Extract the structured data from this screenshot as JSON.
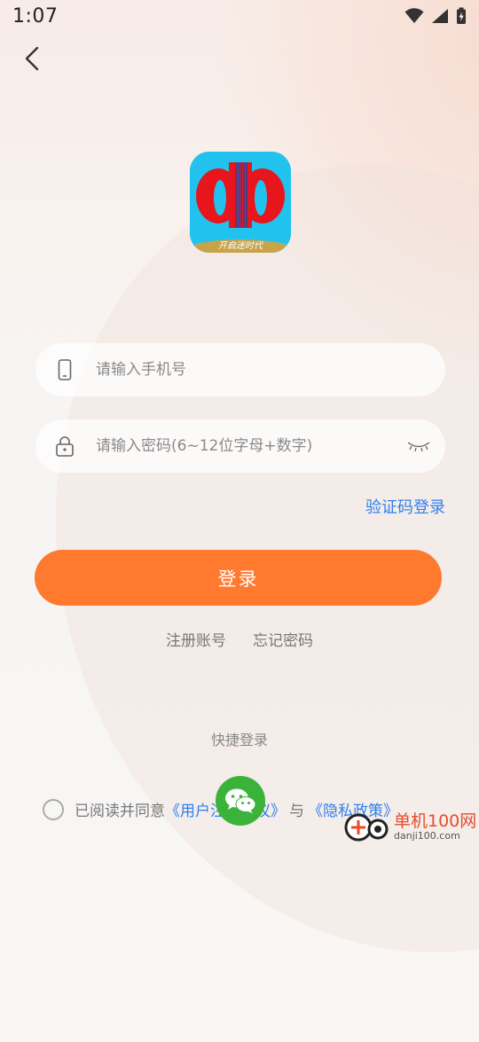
{
  "status_bar": {
    "time": "1:07"
  },
  "navigation": {
    "back_icon": "chevron-left-icon"
  },
  "logo": {
    "letters": "db",
    "banner_text": "开启迷时代"
  },
  "phone_field": {
    "icon": "phone-icon",
    "placeholder": "请输入手机号",
    "value": ""
  },
  "password_field": {
    "icon": "lock-icon",
    "placeholder": "请输入密码(6~12位字母+数字)",
    "value": "",
    "toggle_icon": "eye-closed-icon"
  },
  "code_login_label": "验证码登录",
  "login_button_label": "登录",
  "links": {
    "register": "注册账号",
    "forgot": "忘记密码"
  },
  "quick_login_label": "快捷登录",
  "agreement": {
    "prefix": "已阅读并同意",
    "user_agreement": "《用户注册协议》",
    "connector": "与",
    "privacy_policy": "《隐私政策》",
    "checked": false
  },
  "watermark": {
    "main": "单机100网",
    "sub": "danji100.com"
  },
  "colors": {
    "accent": "#ff7a2f",
    "link": "#2f80ed",
    "wechat": "#3bb33a",
    "logo_bg": "#22c2ef",
    "logo_red": "#e8151d"
  }
}
